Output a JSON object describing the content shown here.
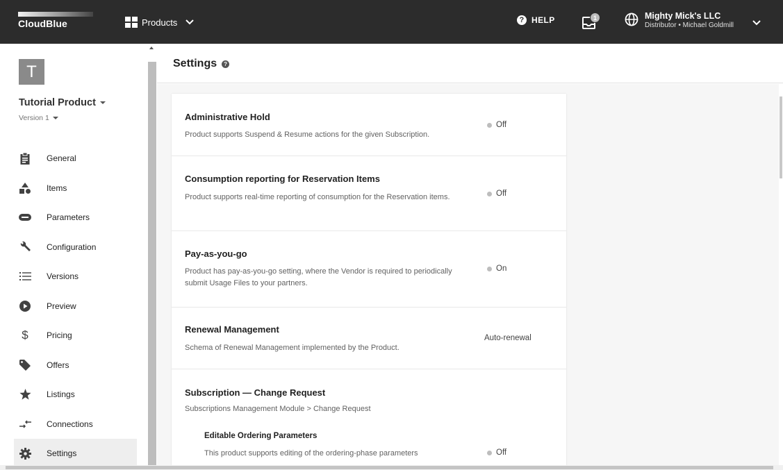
{
  "topbar": {
    "logo_text": "CloudBlue",
    "products_label": "Products",
    "help_label": "HELP",
    "notification_count": "1",
    "account_name": "Mighty Mick's LLC",
    "account_role": "Distributor • Michael Goldmill"
  },
  "product": {
    "avatar_letter": "T",
    "name": "Tutorial Product",
    "version": "Version 1"
  },
  "nav": [
    {
      "label": "General",
      "icon": "clipboard-icon",
      "active": false
    },
    {
      "label": "Items",
      "icon": "shapes-icon",
      "active": false
    },
    {
      "label": "Parameters",
      "icon": "parameters-icon",
      "active": false
    },
    {
      "label": "Configuration",
      "icon": "wrench-icon",
      "active": false
    },
    {
      "label": "Versions",
      "icon": "list-icon",
      "active": false
    },
    {
      "label": "Preview",
      "icon": "play-icon",
      "active": false
    },
    {
      "label": "Pricing",
      "icon": "dollar-icon",
      "active": false
    },
    {
      "label": "Offers",
      "icon": "tag-icon",
      "active": false
    },
    {
      "label": "Listings",
      "icon": "star-icon",
      "active": false
    },
    {
      "label": "Connections",
      "icon": "connections-icon",
      "active": false
    },
    {
      "label": "Settings",
      "icon": "gear-icon",
      "active": true
    }
  ],
  "main": {
    "title": "Settings",
    "settings": [
      {
        "title": "Administrative Hold",
        "desc": "Product supports Suspend & Resume actions for the given Subscription.",
        "value": "Off",
        "dot": true
      },
      {
        "title": "Consumption reporting for Reservation Items",
        "desc": "Product supports real-time reporting of consumption for the Reservation items.",
        "value": "Off",
        "dot": true
      },
      {
        "title": "Pay-as-you-go",
        "desc": "Product has pay-as-you-go setting, where the Vendor is required to periodically submit Usage Files to your partners.",
        "value": "On",
        "dot": true
      },
      {
        "title": "Renewal Management",
        "desc": "Schema of Renewal Management implemented by the Product.",
        "value": "Auto-renewal",
        "dot": false
      },
      {
        "title": "Subscription — Change Request",
        "desc": "Subscriptions Management Module > Change Request",
        "sub_title": "Editable Ordering Parameters",
        "sub_desc": "This product supports editing of the ordering-phase parameters",
        "value": "Off",
        "dot": true
      }
    ]
  },
  "colors": {
    "topbar_bg": "#2c2c2c",
    "content_bg": "#f6f6f6",
    "active_nav_bg": "#eeeeee",
    "status_dot": "#bdbdbd"
  }
}
